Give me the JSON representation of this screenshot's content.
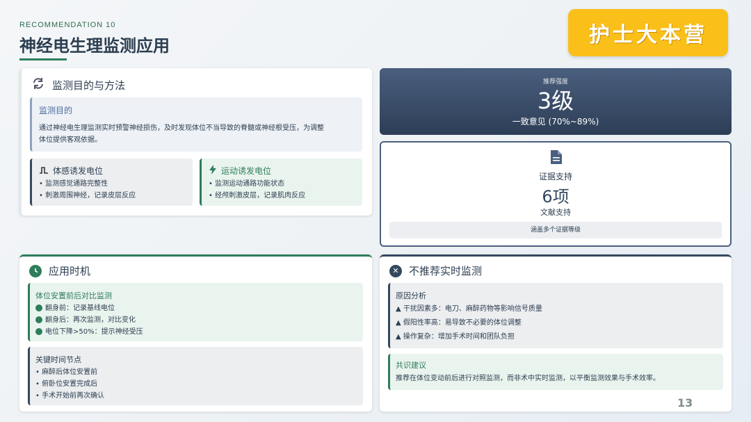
{
  "header": {
    "eyebrow": "RECOMMENDATION 10",
    "title": "神经电生理监测应用",
    "brand": "护士大本营",
    "page_number": "13"
  },
  "purpose": {
    "title": "监测目的与方法",
    "goal_label": "监测目的",
    "goal_text_1": "通过神经电生理监测实时预警神经损伤，及时发现体位不当导致的脊髓或神经根受压，为调整",
    "goal_text_2": "体位提供客观依据。",
    "ssep": {
      "title": "体感诱发电位",
      "items": [
        "监测感觉通路完整性",
        "刺激周围神经，记录皮层反应"
      ]
    },
    "mep": {
      "title": "运动诱发电位",
      "items": [
        "监测运动通路功能状态",
        "经颅刺激皮层，记录肌肉反应"
      ]
    }
  },
  "recommendation": {
    "label": "推荐强度",
    "level": "3级",
    "consensus": "一致意见 (70%~89%)"
  },
  "evidence": {
    "label": "证据支持",
    "count": "6项",
    "sublabel": "文献支持",
    "note": "涵盖多个证据等级"
  },
  "timing": {
    "title": "应用时机",
    "compare_label": "体位安置前后对比监测",
    "compare_items": [
      "翻身前：记录基线电位",
      "翻身后：再次监测，对比变化",
      "电位下降>50%：提示神经受压"
    ],
    "key_label": "关键时间节点",
    "key_items": [
      "麻醉后体位安置前",
      "俯卧位安置完成后",
      "手术开始前再次确认"
    ]
  },
  "not_recommended": {
    "title": "不推荐实时监测",
    "reason_label": "原因分析",
    "reason_items": [
      "干扰因素多：电刀、麻醉药物等影响信号质量",
      "假阳性率高：易导致不必要的体位调整",
      "操作复杂：增加手术时间和团队负担"
    ],
    "consensus_label": "共识建议",
    "consensus_text": "推荐在体位变动前后进行对照监测，而非术中实时监测，以平衡监测效果与手术效率。"
  },
  "colors": {
    "green": "#2e7d5b",
    "navy": "#34495e",
    "brand_yellow": "#fbbf1a"
  }
}
